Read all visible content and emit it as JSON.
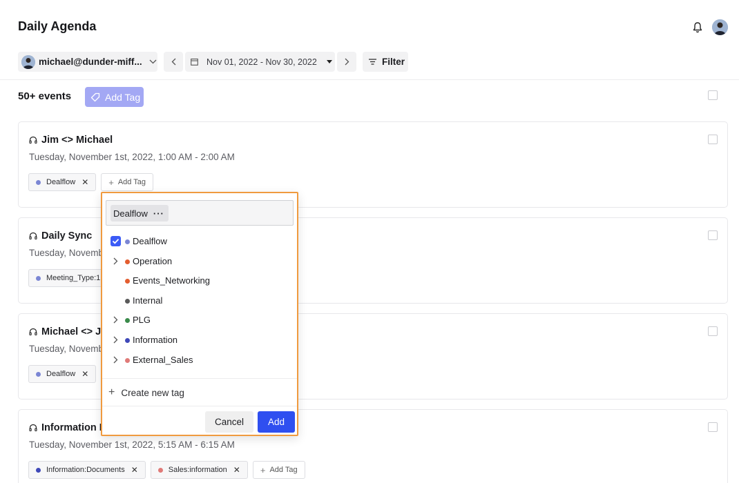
{
  "header": {
    "title": "Daily Agenda"
  },
  "toolbar": {
    "account_label": "michael@dunder-miff...",
    "date_range": "Nov 01, 2022 - Nov 30, 2022",
    "filter_label": "Filter"
  },
  "summary": {
    "count_label": "50+ events",
    "add_tag_label": "Add Tag"
  },
  "events": [
    {
      "title": "Jim <> Michael",
      "time": "Tuesday, November 1st, 2022, 1:00 AM - 2:00 AM",
      "tags": [
        {
          "label": "Dealflow",
          "color": "#7b86d4"
        }
      ],
      "add_tag_label": "Add Tag"
    },
    {
      "title": "Daily Sync",
      "time": "Tuesday, Novemb",
      "tags": [
        {
          "label": "Meeting_Type:1",
          "color": "#7b86d4"
        }
      ]
    },
    {
      "title": "Michael <> J",
      "time": "Tuesday, Novemb",
      "tags": [
        {
          "label": "Dealflow",
          "color": "#7b86d4"
        }
      ]
    },
    {
      "title": "Information I",
      "time": "Tuesday, November 1st, 2022, 5:15 AM - 6:15 AM",
      "tags": [
        {
          "label": "Information:Documents",
          "color": "#3f48b8"
        },
        {
          "label": "Sales:information",
          "color": "#e07a78"
        }
      ],
      "add_tag_label": "Add Tag"
    }
  ],
  "tag_picker": {
    "selected_chip": "Dealflow",
    "options": [
      {
        "label": "Dealflow",
        "color": "#7b86d4",
        "checked": true,
        "expandable": false
      },
      {
        "label": "Operation",
        "color": "#e35d2f",
        "checked": false,
        "expandable": true
      },
      {
        "label": "Events_Networking",
        "color": "#e35d2f",
        "checked": false,
        "expandable": false
      },
      {
        "label": "Internal",
        "color": "#5a5a5a",
        "checked": false,
        "expandable": false
      },
      {
        "label": "PLG",
        "color": "#3a8a4a",
        "checked": false,
        "expandable": true
      },
      {
        "label": "Information",
        "color": "#3f48b8",
        "checked": false,
        "expandable": true
      },
      {
        "label": "External_Sales",
        "color": "#e07a78",
        "checked": false,
        "expandable": true
      }
    ],
    "create_label": "Create new tag",
    "cancel_label": "Cancel",
    "add_label": "Add"
  },
  "colors": {
    "accent": "#2f4ff0",
    "add_tag_bg": "#a3a8f4",
    "highlight_border": "#f09a3e"
  }
}
